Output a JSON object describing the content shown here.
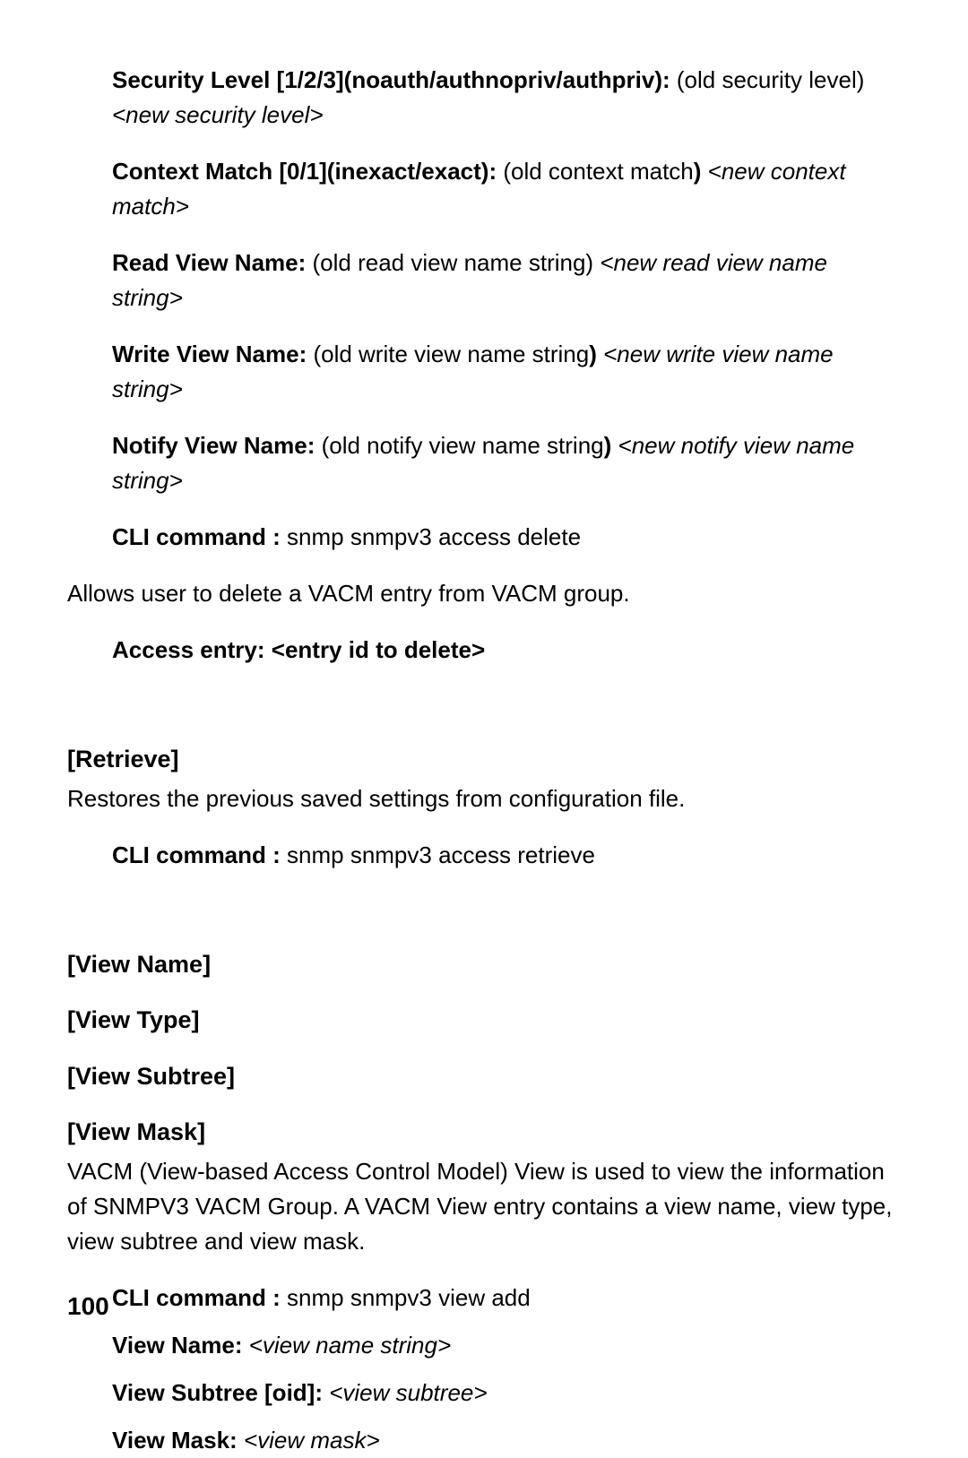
{
  "items": [
    {
      "label_bold": "Security Level [1/2/3](noauth/authnopriv/authpriv): ",
      "label_plain": "(old security level)",
      "value_italic": "<new security level>"
    },
    {
      "label_bold": "Context Match [0/1](inexact/exact): ",
      "label_plain": "(old context match",
      "label_bold2": ") ",
      "value_italic": "<new context match>"
    },
    {
      "label_bold": "Read View Name: ",
      "label_plain": "(old read view name string) ",
      "value_italic": "<new read view name string>"
    },
    {
      "label_bold": "Write View Name: ",
      "label_plain": "(old write view name string",
      "label_bold2": ") ",
      "value_italic": "<new write view name string>"
    },
    {
      "label_bold": "Notify View Name: ",
      "label_plain": "(old notify view name string",
      "label_bold2": ") ",
      "value_italic": "<new notify view name string>"
    }
  ],
  "cli_delete": {
    "label": "CLI command : ",
    "value": "snmp snmpv3 access delete"
  },
  "delete_desc": "Allows user to delete a VACM entry from VACM group.",
  "access_entry": "Access entry: <entry id to delete>",
  "retrieve": {
    "heading": "[Retrieve]",
    "desc": "Restores the previous saved settings from configuration file."
  },
  "cli_retrieve": {
    "label": "CLI command : ",
    "value": "snmp snmpv3 access retrieve"
  },
  "view_name_h": "[View Name]",
  "view_type_h": "[View Type]",
  "view_subtree_h": "[View Subtree]",
  "view_mask_h": "[View Mask]",
  "vacm_desc": "VACM (View-based Access Control Model) View is used to view the information of SNMPV3 VACM Group. A VACM View entry contains a view name, view type, view subtree and view mask.",
  "cli_view_add": {
    "label": "CLI command : ",
    "value": "snmp snmpv3 view add"
  },
  "view_name_line": {
    "label": "View Name: ",
    "value": "<view name string>"
  },
  "view_subtree_line": {
    "label": "View Subtree [oid]: ",
    "value": "<view subtree>"
  },
  "view_mask_line": {
    "label": "View Mask: ",
    "value": "<view mask>"
  },
  "page_number": "100"
}
